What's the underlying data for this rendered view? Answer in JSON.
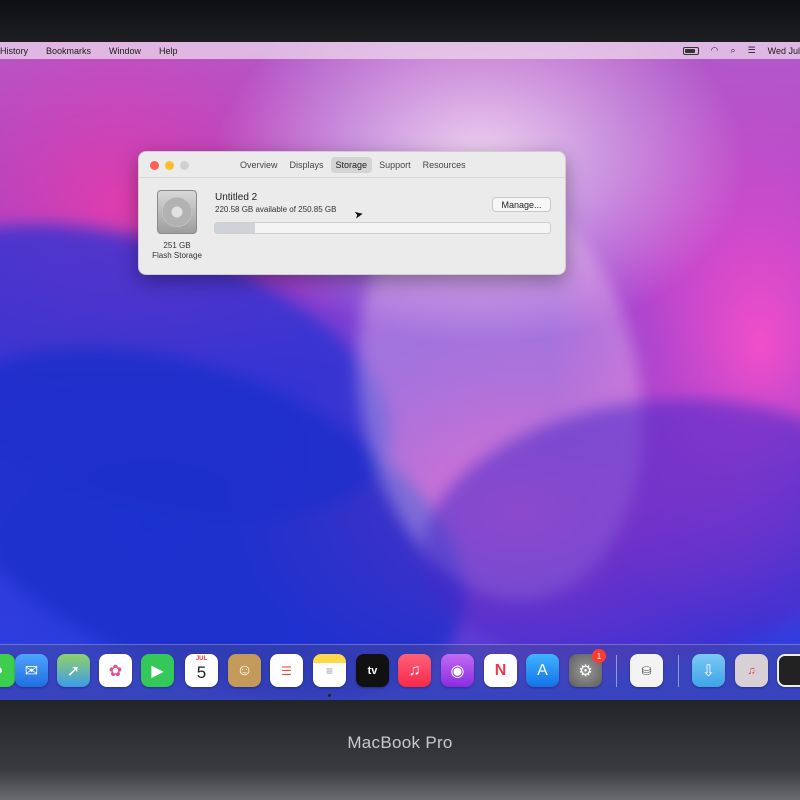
{
  "menubar": {
    "items": [
      "History",
      "Bookmarks",
      "Window",
      "Help"
    ],
    "clock": "Wed Jul"
  },
  "window": {
    "tabs": [
      "Overview",
      "Displays",
      "Storage",
      "Support",
      "Resources"
    ],
    "active_tab": "Storage",
    "drive": {
      "size": "251 GB",
      "type": "Flash Storage"
    },
    "volume": {
      "name": "Untitled 2",
      "availability": "220.58 GB available of 250.85 GB",
      "used_fraction": 0.12
    },
    "manage_label": "Manage..."
  },
  "dock": {
    "calendar": {
      "month": "JUL",
      "day": "5"
    },
    "tv_label": "tv",
    "system_prefs_badge": "1"
  },
  "colors": {
    "close": "#fe5f57",
    "minimize": "#febc2e",
    "accent": "#0a84ff"
  },
  "laptop": {
    "model": "MacBook Pro"
  }
}
